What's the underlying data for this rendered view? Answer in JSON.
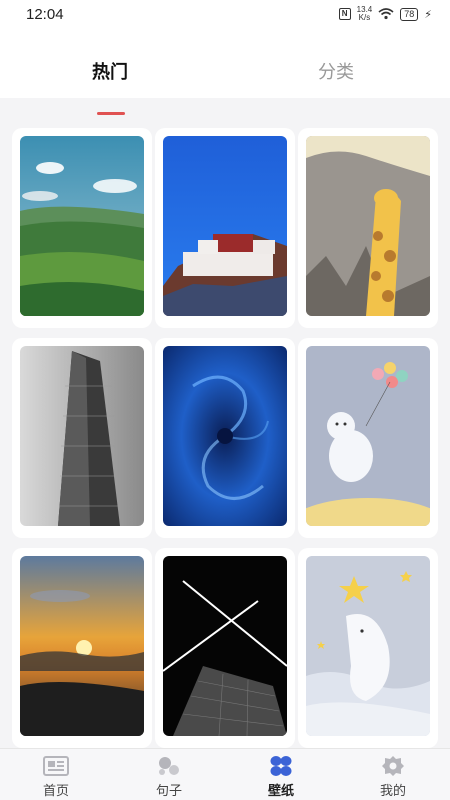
{
  "status_bar": {
    "time": "12:04",
    "nfc_label": "N",
    "speed_value": "13.4",
    "speed_unit": "K/s",
    "battery": "78",
    "charging_icon": "bolt-icon",
    "wifi_icon": "wifi-icon"
  },
  "top_tabs": [
    {
      "label": "热门",
      "active": true
    },
    {
      "label": "分类",
      "active": false
    }
  ],
  "colors": {
    "accent": "#e05252",
    "active_tab_icon": "#3b63d6",
    "inactive_icon": "#b5b5bb"
  },
  "wallpapers": [
    {
      "name": "green-hills-landscape"
    },
    {
      "name": "palace-on-hill-blue-sky"
    },
    {
      "name": "giraffe-illustration"
    },
    {
      "name": "skyscraper-grayscale"
    },
    {
      "name": "blue-swirl-abstract"
    },
    {
      "name": "polar-bear-balloons-illustration"
    },
    {
      "name": "sunset-over-clouds"
    },
    {
      "name": "building-with-jet-trails"
    },
    {
      "name": "dolphin-star-illustration"
    }
  ],
  "bottom_nav": [
    {
      "label": "首页",
      "icon": "home-news-icon",
      "active": false
    },
    {
      "label": "句子",
      "icon": "bubbles-icon",
      "active": false
    },
    {
      "label": "壁纸",
      "icon": "grid-petals-icon",
      "active": true
    },
    {
      "label": "我的",
      "icon": "gear-icon",
      "active": false
    }
  ]
}
